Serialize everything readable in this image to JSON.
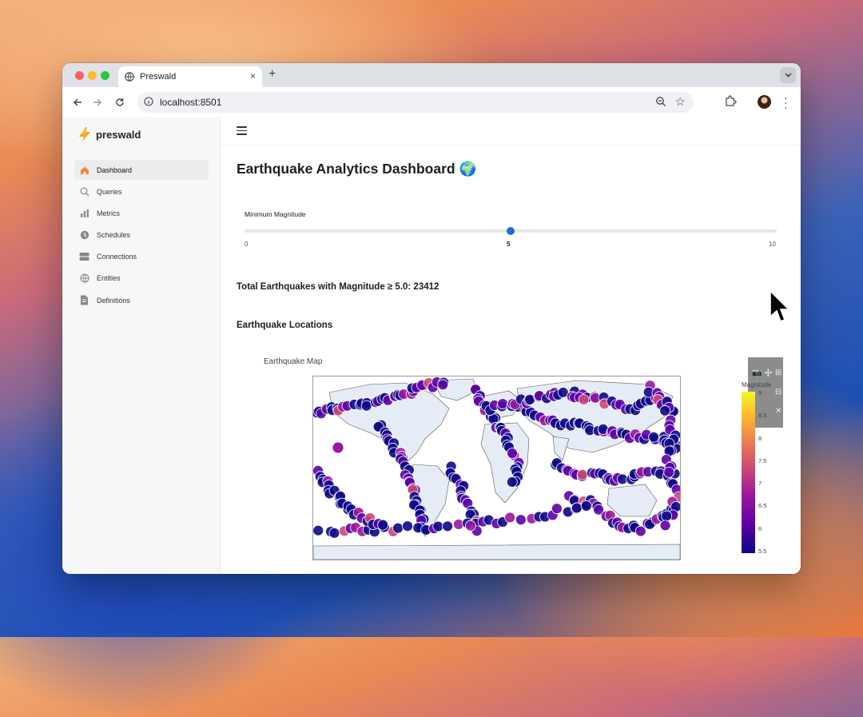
{
  "browser": {
    "tab_title": "Preswald",
    "url": "localhost:8501",
    "new_tab_symbol": "+",
    "tab_close_symbol": "×"
  },
  "sidebar": {
    "brand": "preswald",
    "items": [
      {
        "label": "Dashboard",
        "icon": "home-icon",
        "active": true
      },
      {
        "label": "Queries",
        "icon": "search-icon",
        "active": false
      },
      {
        "label": "Metrics",
        "icon": "bar-chart-icon",
        "active": false
      },
      {
        "label": "Schedules",
        "icon": "clock-icon",
        "active": false
      },
      {
        "label": "Connections",
        "icon": "database-icon",
        "active": false
      },
      {
        "label": "Entities",
        "icon": "globe-icon",
        "active": false
      },
      {
        "label": "Definitions",
        "icon": "document-icon",
        "active": false
      }
    ]
  },
  "main": {
    "title": "Earthquake Analytics Dashboard 🌍",
    "slider": {
      "label": "Minimum Magnitude",
      "min": 0,
      "max": 10,
      "value": 5,
      "min_label": "0",
      "value_label": "5",
      "max_label": "10",
      "accent": "#1f6fd6"
    },
    "total_text": "Total Earthquakes with Magnitude ≥ 5.0: 23412",
    "section_heading": "Earthquake Locations"
  },
  "chart_data": {
    "type": "scatter",
    "title": "Earthquake Map",
    "colorbar_title": "Magnitude",
    "colorbar_range": [
      5.5,
      9
    ],
    "colorbar_ticks": [
      "9",
      "8.5",
      "8",
      "7.5",
      "7",
      "6.5",
      "6",
      "5.5"
    ],
    "colorscale": [
      "#0d0887",
      "#5c01a6",
      "#9c179e",
      "#cc4778",
      "#ed7953",
      "#fdb42f",
      "#f0f921"
    ]
  }
}
